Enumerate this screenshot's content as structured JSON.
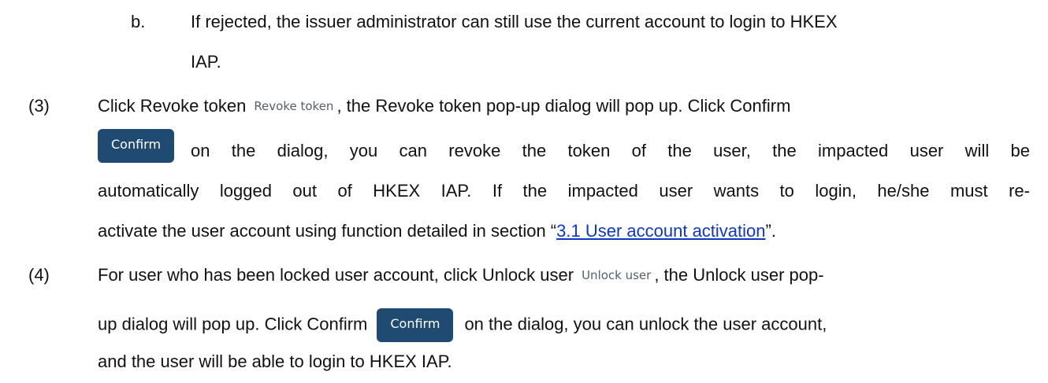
{
  "item_b": {
    "marker": "b.",
    "line1": "If rejected, the issuer administrator can still use the current account to login to HKEX",
    "line2": "IAP."
  },
  "item_3": {
    "marker": "(3)",
    "line1_a": "Click Revoke token",
    "revoke_link": "Revoke token",
    "line1_b": ", the Revoke token pop-up dialog will pop up. Click Confirm",
    "confirm_button": "Confirm",
    "line2": "on the dialog, you can revoke the token of the user, the impacted user will be",
    "line3": "automatically logged out of HKEX IAP. If the impacted user wants to login, he/she must re-",
    "line4_a": "activate the user account using function detailed in section “",
    "section_link": "3.1 User account activation",
    "line4_b": "”."
  },
  "item_4": {
    "marker": "(4)",
    "line1_a": "For user who has been locked user account, click Unlock user",
    "unlock_link": "Unlock user",
    "line1_b": ", the Unlock user pop-",
    "line2_a": "up dialog will pop up. Click Confirm",
    "confirm_button": "Confirm",
    "line2_b": "on the dialog, you can unlock the user account,",
    "line3": "and the user will be able to login to HKEX IAP."
  }
}
